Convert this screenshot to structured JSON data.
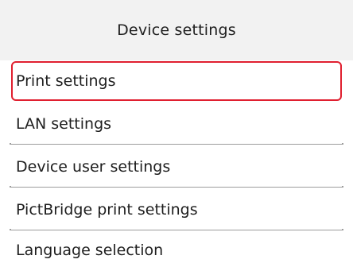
{
  "header": {
    "title": "Device settings"
  },
  "menu": {
    "items": [
      {
        "label": "Print settings",
        "selected": true
      },
      {
        "label": "LAN settings",
        "selected": false
      },
      {
        "label": "Device user settings",
        "selected": false
      },
      {
        "label": "PictBridge print settings",
        "selected": false
      },
      {
        "label": "Language selection",
        "selected": false
      }
    ]
  },
  "colors": {
    "header_background": "#f2f2f2",
    "selection_border": "#e01f2f",
    "divider": "#9c9c9c",
    "text": "#1e1e1e"
  }
}
